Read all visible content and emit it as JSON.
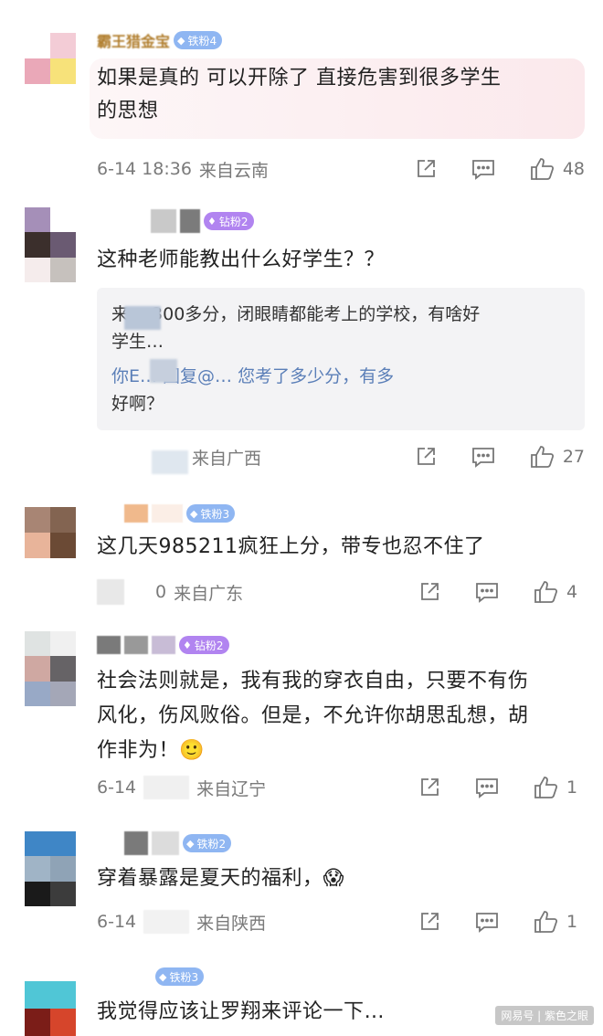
{
  "comments": [
    {
      "user": "霸王猎金宝",
      "badge": "铁粉4",
      "badge_type": "iron",
      "text_lines": [
        "如果是真的  可以开除了  直接危害到很多学生",
        "的思想"
      ],
      "time": "6-14 18:36",
      "location": "来自云南",
      "likes": "48",
      "avatar_colors": [
        "#ffffff",
        "#f3ccd6",
        "#eaa8b8",
        "#f7e27a"
      ]
    },
    {
      "badge": "钻粉2",
      "badge_type": "diamond",
      "text_lines": [
        "这种老师能教出什么好学生？？"
      ],
      "quote_lines": [
        "来…  300多分，闭眼睛都能考上的学校，有啥好",
        "学生…"
      ],
      "quote_reply": [
        "你E…      回复@…      您考了多少分，有多",
        "好啊？"
      ],
      "time": "",
      "location": "来自广西",
      "likes": "27",
      "avatar_colors": [
        "#a58fb8",
        "#ffffff",
        "#3b2f2c",
        "#6a5a72",
        "#f5ecec",
        "#c6c1bd"
      ]
    },
    {
      "badge": "铁粉3",
      "badge_type": "iron",
      "text_lines": [
        "这几天985211疯狂上分，带专也忍不住了"
      ],
      "time": "0",
      "location": "来自广东",
      "likes": "4",
      "avatar_colors": [
        "#a88574",
        "#836451",
        "#e8b49a",
        "#6b4a35"
      ]
    },
    {
      "badge": "钻粉2",
      "badge_type": "diamond",
      "text_lines": [
        "社会法则就是，我有我的穿衣自由，只要不有伤",
        "风化，伤风败俗。但是，不允许你胡思乱想，胡",
        "作非为！🙂"
      ],
      "time": "6-14",
      "location": "来自辽宁",
      "likes": "1",
      "avatar_colors": [
        "#dfe3e2",
        "#f0f0f0",
        "#cfa8a2",
        "#666366",
        "#98a9c6",
        "#a4a7b7"
      ]
    },
    {
      "badge": "铁粉2",
      "badge_type": "iron",
      "text_lines": [
        "穿着暴露是夏天的福利，😱"
      ],
      "time": "6-14",
      "location": "来自陕西",
      "likes": "1",
      "avatar_colors": [
        "#3f86c6",
        "#3f86c6",
        "#a0b4c6",
        "#8fa3b6",
        "#1a1a1a",
        "#3c3c3c"
      ]
    },
    {
      "badge": "铁粉3",
      "badge_type": "iron",
      "text_lines": [
        "我觉得应该让罗翔来评论一下…"
      ],
      "avatar_colors": [
        "#50c6d6",
        "#50c6d6",
        "#7b1d18",
        "#d6452b"
      ]
    }
  ],
  "watermark": "网易号 | 紫色之眼",
  "icons": {
    "share": "share-icon",
    "comment": "comment-icon",
    "like": "like-icon",
    "badge_iron": "iron-gem-icon",
    "badge_diamond": "diamond-gem-icon"
  },
  "colors": {
    "meta": "#7a7a7a",
    "quote_bg": "#f3f3f5",
    "link_blue": "#5b7fb8",
    "diamond_badge": "#b184f0",
    "iron_badge": "#8fb6f2"
  }
}
